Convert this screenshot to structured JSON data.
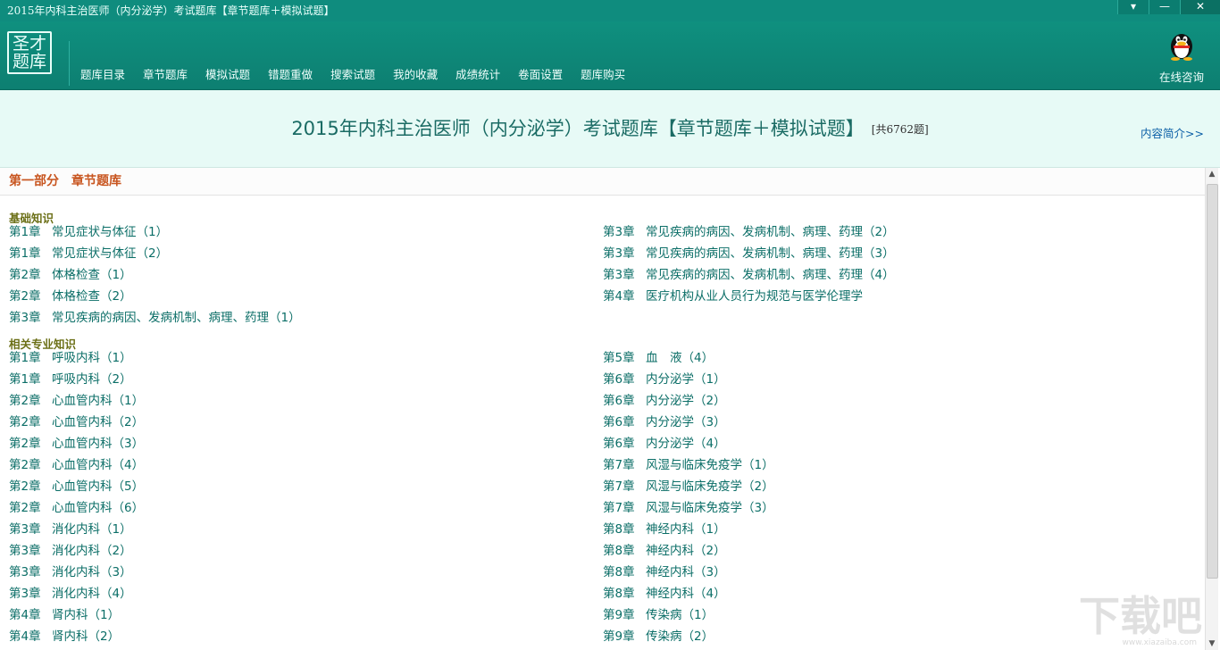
{
  "window": {
    "title": "2015年内科主治医师（内分泌学）考试题库【章节题库＋模拟试题】",
    "buttons": {
      "menu": "▾",
      "minimize": "—",
      "close": "✕"
    }
  },
  "logo": {
    "line1": "圣才",
    "line2": "题库"
  },
  "menu": [
    "题库目录",
    "章节题库",
    "模拟试题",
    "错题重做",
    "搜索试题",
    "我的收藏",
    "成绩统计",
    "卷面设置",
    "题库购买"
  ],
  "consult": {
    "label": "在线咨询",
    "icon": "qq-penguin-icon"
  },
  "banner": {
    "title": "2015年内科主治医师（内分泌学）考试题库【章节题库＋模拟试题】",
    "count": "[共6762题]",
    "intro_link": "内容简介>>"
  },
  "part_heading": "第一部分　章节题库",
  "sections": [
    {
      "title": "基础知识",
      "left": [
        {
          "chapter": "第1章",
          "name": "常见症状与体征（1）"
        },
        {
          "chapter": "第1章",
          "name": "常见症状与体征（2）"
        },
        {
          "chapter": "第2章",
          "name": "体格检查（1）"
        },
        {
          "chapter": "第2章",
          "name": "体格检查（2）"
        },
        {
          "chapter": "第3章",
          "name": "常见疾病的病因、发病机制、病理、药理（1）"
        }
      ],
      "right": [
        {
          "chapter": "第3章",
          "name": "常见疾病的病因、发病机制、病理、药理（2）"
        },
        {
          "chapter": "第3章",
          "name": "常见疾病的病因、发病机制、病理、药理（3）"
        },
        {
          "chapter": "第3章",
          "name": "常见疾病的病因、发病机制、病理、药理（4）"
        },
        {
          "chapter": "第4章",
          "name": "医疗机构从业人员行为规范与医学伦理学"
        }
      ]
    },
    {
      "title": "相关专业知识",
      "left": [
        {
          "chapter": "第1章",
          "name": "呼吸内科（1）"
        },
        {
          "chapter": "第1章",
          "name": "呼吸内科（2）"
        },
        {
          "chapter": "第2章",
          "name": "心血管内科（1）"
        },
        {
          "chapter": "第2章",
          "name": "心血管内科（2）"
        },
        {
          "chapter": "第2章",
          "name": "心血管内科（3）"
        },
        {
          "chapter": "第2章",
          "name": "心血管内科（4）"
        },
        {
          "chapter": "第2章",
          "name": "心血管内科（5）"
        },
        {
          "chapter": "第2章",
          "name": "心血管内科（6）"
        },
        {
          "chapter": "第3章",
          "name": "消化内科（1）"
        },
        {
          "chapter": "第3章",
          "name": "消化内科（2）"
        },
        {
          "chapter": "第3章",
          "name": "消化内科（3）"
        },
        {
          "chapter": "第3章",
          "name": "消化内科（4）"
        },
        {
          "chapter": "第4章",
          "name": "肾内科（1）"
        },
        {
          "chapter": "第4章",
          "name": "肾内科（2）"
        }
      ],
      "right": [
        {
          "chapter": "第5章",
          "name": "血　液（4）"
        },
        {
          "chapter": "第6章",
          "name": "内分泌学（1）"
        },
        {
          "chapter": "第6章",
          "name": "内分泌学（2）"
        },
        {
          "chapter": "第6章",
          "name": "内分泌学（3）"
        },
        {
          "chapter": "第6章",
          "name": "内分泌学（4）"
        },
        {
          "chapter": "第7章",
          "name": "风湿与临床免疫学（1）"
        },
        {
          "chapter": "第7章",
          "name": "风湿与临床免疫学（2）"
        },
        {
          "chapter": "第7章",
          "name": "风湿与临床免疫学（3）"
        },
        {
          "chapter": "第8章",
          "name": "神经内科（1）"
        },
        {
          "chapter": "第8章",
          "name": "神经内科（2）"
        },
        {
          "chapter": "第8章",
          "name": "神经内科（3）"
        },
        {
          "chapter": "第8章",
          "name": "神经内科（4）"
        },
        {
          "chapter": "第9章",
          "name": "传染病（1）"
        },
        {
          "chapter": "第9章",
          "name": "传染病（2）"
        }
      ]
    }
  ],
  "watermark": {
    "main": "下载吧",
    "sub": "www.xiazaiba.com"
  },
  "colors": {
    "titlebar": "#0f8c7e",
    "banner_bg": "#e7faf6",
    "link": "#0b6e67",
    "section": "#6b6f16",
    "part": "#c8551f"
  }
}
